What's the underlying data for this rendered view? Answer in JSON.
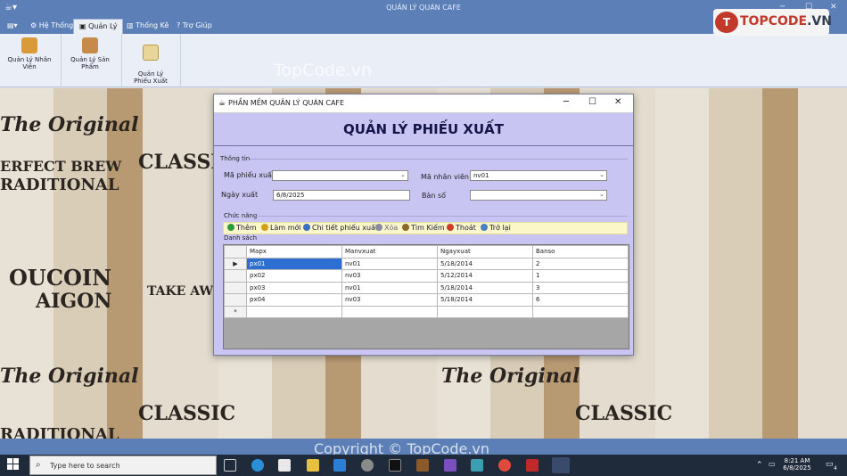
{
  "window": {
    "title": "QUẢN LÝ QUÁN CAFE",
    "minimize": "─",
    "maximize": "☐",
    "close": "✕"
  },
  "menu": {
    "tabs": [
      {
        "label": "Hệ Thống",
        "icon": "gear-icon"
      },
      {
        "label": "Quản Lý",
        "icon": "briefcase-icon"
      },
      {
        "label": "Thống Kê",
        "icon": "chart-icon"
      },
      {
        "label": "Trợ Giúp",
        "icon": "help-icon"
      }
    ],
    "active": "Quản Lý"
  },
  "ribbon": {
    "buttons": [
      {
        "label": "Quản Lý Nhân Viên"
      },
      {
        "label": "Quản Lý Sản Phẩm"
      },
      {
        "label": "Quản Lý\nPhiếu Xuất"
      }
    ]
  },
  "brand": {
    "logo_text": "TOPCODE",
    "logo_tld": ".VN",
    "watermark_top": "TopCode.vn",
    "watermark_bottom": "Copyright © TopCode.vn"
  },
  "background": {
    "texts": [
      "The Original",
      "ERFECT BREW",
      "RADITIONAL",
      "CLASSIC",
      "OUCOIN",
      "AIGON",
      "TAKE AW",
      "The Original",
      "CLASSIC",
      "RADITIONAL",
      "The Original",
      "CLASSIC"
    ]
  },
  "dialog": {
    "title": "PHẦN MỀM QUẢN LÝ QUÁN CAFE",
    "heading": "QUẢN LÝ PHIẾU XUẤT",
    "info_group": "Thông tin",
    "fields": {
      "ma_phieu_xuat": {
        "label": "Mã phiếu xuất",
        "value": ""
      },
      "ma_nhan_vien": {
        "label": "Mã nhân viên",
        "value": "nv01"
      },
      "ngay_xuat": {
        "label": "Ngày xuất",
        "value": "6/8/2025"
      },
      "ban_so": {
        "label": "Bàn số",
        "value": ""
      }
    },
    "function_group": "Chức năng",
    "toolbar": [
      {
        "label": "Thêm",
        "color": "#2e9b3a"
      },
      {
        "label": "Làm mới",
        "color": "#d4a017"
      },
      {
        "label": "Chi tiết phiếu xuất",
        "color": "#3a6fc4"
      },
      {
        "label": "Xóa",
        "color": "#8a8aa0"
      },
      {
        "label": "Tìm Kiếm",
        "color": "#8a6a2a"
      },
      {
        "label": "Thoát",
        "color": "#d03a2a"
      },
      {
        "label": "Trở lại",
        "color": "#4a7fc0"
      }
    ],
    "list_group": "Danh sách",
    "table": {
      "columns": [
        "Mapx",
        "Manvxuat",
        "Ngayxuat",
        "Banso"
      ],
      "rows": [
        [
          "px01",
          "nv01",
          "5/18/2014",
          "2"
        ],
        [
          "px02",
          "nv03",
          "5/12/2014",
          "1"
        ],
        [
          "px03",
          "nv01",
          "5/18/2014",
          "3"
        ],
        [
          "px04",
          "nv03",
          "5/18/2014",
          "6"
        ]
      ],
      "current_marker": "▶",
      "new_row_marker": "*"
    }
  },
  "taskbar": {
    "search_placeholder": "Type here to search",
    "time": "8:21 AM",
    "date": "6/8/2025",
    "notifications": "4"
  }
}
